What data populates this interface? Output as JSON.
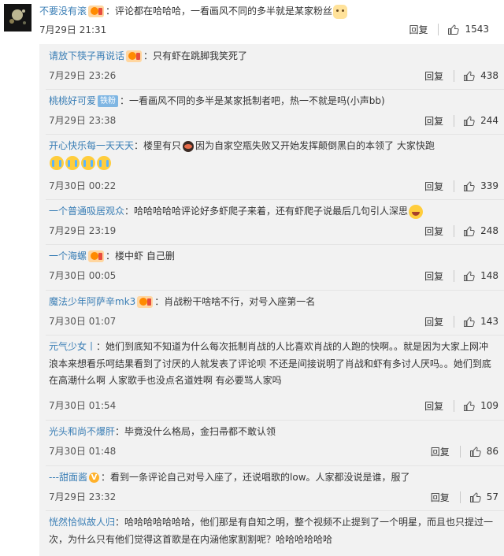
{
  "main_comment": {
    "username": "不要没有滚",
    "text": "评论都在哈哈哈，一看画风不同的多半就是某家粉丝",
    "date": "7月29日 21:31",
    "reply_label": "回复",
    "likes": "1543"
  },
  "replies": [
    {
      "username": "请放下筷子再说话",
      "text": "只有虾在跳脚我笑死了",
      "date": "7月29日 23:26",
      "reply_label": "回复",
      "likes": "438"
    },
    {
      "username": "桃桃好可爱",
      "tag": "铁粉",
      "text": "一看画风不同的多半是某家抵制者吧，热一不就是吗(小声bb)",
      "date": "7月29日 23:38",
      "reply_label": "回复",
      "likes": "244"
    },
    {
      "username": "开心快乐每一天天天",
      "text_a": "楼里有只",
      "text_b": "因为自家空瓶失败又开始发挥颠倒黑白的本领了 大家快跑",
      "date": "7月30日 00:22",
      "reply_label": "回复",
      "likes": "339"
    },
    {
      "username": "一个普通吸居观众",
      "text": "哈哈哈哈哈评论好多虾爬子来着，还有虾爬子说最后几句引人深思",
      "date": "7月29日 23:19",
      "reply_label": "回复",
      "likes": "248"
    },
    {
      "username": "一个海螺",
      "text": "楼中虾 自己删",
      "date": "7月30日 00:05",
      "reply_label": "回复",
      "likes": "148"
    },
    {
      "username": "魔法少年阿萨辛mk3",
      "text": "肖战粉干啥啥不行，对号入座第一名",
      "date": "7月30日 01:07",
      "reply_label": "回复",
      "likes": "143"
    },
    {
      "username": "元气少女丨",
      "text": "她们到底知不知道为什么每次抵制肖战的人比喜欢肖战的人跑的快啊。。就是因为大家上网冲浪本来想看乐呵结果看到了讨厌的人就发表了评论呗 不还是间接说明了肖战和虾有多讨人厌吗。。她们到底在高潮什么啊 人家歌手也没点名道姓啊 有必要骂人家吗",
      "date": "7月30日 01:54",
      "reply_label": "回复",
      "likes": "109"
    },
    {
      "username": "光头和尚不爆肝",
      "text": "毕竟没什么格局，金扫帚都不敢认领",
      "date": "7月30日 01:48",
      "reply_label": "回复",
      "likes": "86"
    },
    {
      "username": "---甜面酱",
      "text": "看到一条评论自己对号入座了，还说唱歌的low。人家都没说是谁，服了",
      "date": "7月29日 23:32",
      "reply_label": "回复",
      "likes": "57"
    },
    {
      "username": "恍然恰似故人归",
      "text": "哈哈哈哈哈哈哈，他们那是有自知之明，整个视频不止提到了一个明星，而且也只提过一次，为什么只有他们觉得这首歌是在内涵他家割割呢？哈哈哈哈哈哈"
    }
  ]
}
